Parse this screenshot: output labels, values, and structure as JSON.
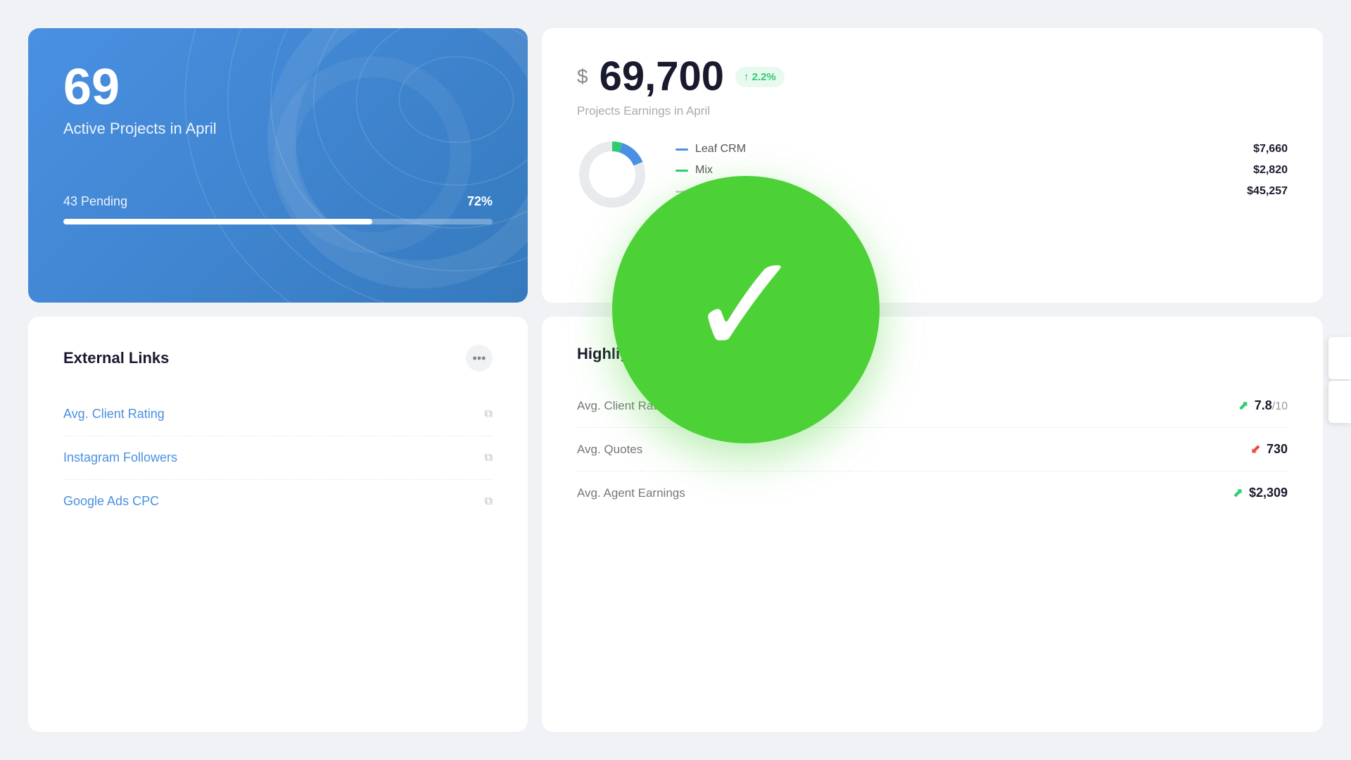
{
  "card1": {
    "count": "69",
    "label": "Active Projects in April",
    "pending_text": "43 Pending",
    "percent": "72%",
    "progress_width": "72"
  },
  "card2": {
    "dollar_sign": "$",
    "amount": "69,700",
    "badge": "↑ 2.2%",
    "subtitle": "Projects Earnings in April",
    "legend": [
      {
        "name": "Leaf CRM",
        "value": "$7,660",
        "color": "#4a90e2"
      },
      {
        "name": "Mix",
        "value": "$2,820",
        "color": "#2ecc71"
      },
      {
        "name": "",
        "value": "$45,257",
        "color": "#e8eaed"
      }
    ]
  },
  "card3": {
    "title": "External Links",
    "more_label": "•••",
    "links": [
      {
        "label": "Avg. Client Rating"
      },
      {
        "label": "Instagram Followers"
      },
      {
        "label": "Google Ads CPC"
      }
    ]
  },
  "card4": {
    "title": "Highlights",
    "items": [
      {
        "label": "Avg. Client Rating",
        "trend": "up",
        "value": "7.8",
        "suffix": "/10"
      },
      {
        "label": "Avg. Quotes",
        "trend": "down",
        "value": "730",
        "suffix": ""
      },
      {
        "label": "Avg. Agent Earnings",
        "trend": "up",
        "value": "$2,309",
        "suffix": ""
      }
    ]
  },
  "checkmark": "✓",
  "right_tabs": [
    "tab1",
    "tab2"
  ]
}
